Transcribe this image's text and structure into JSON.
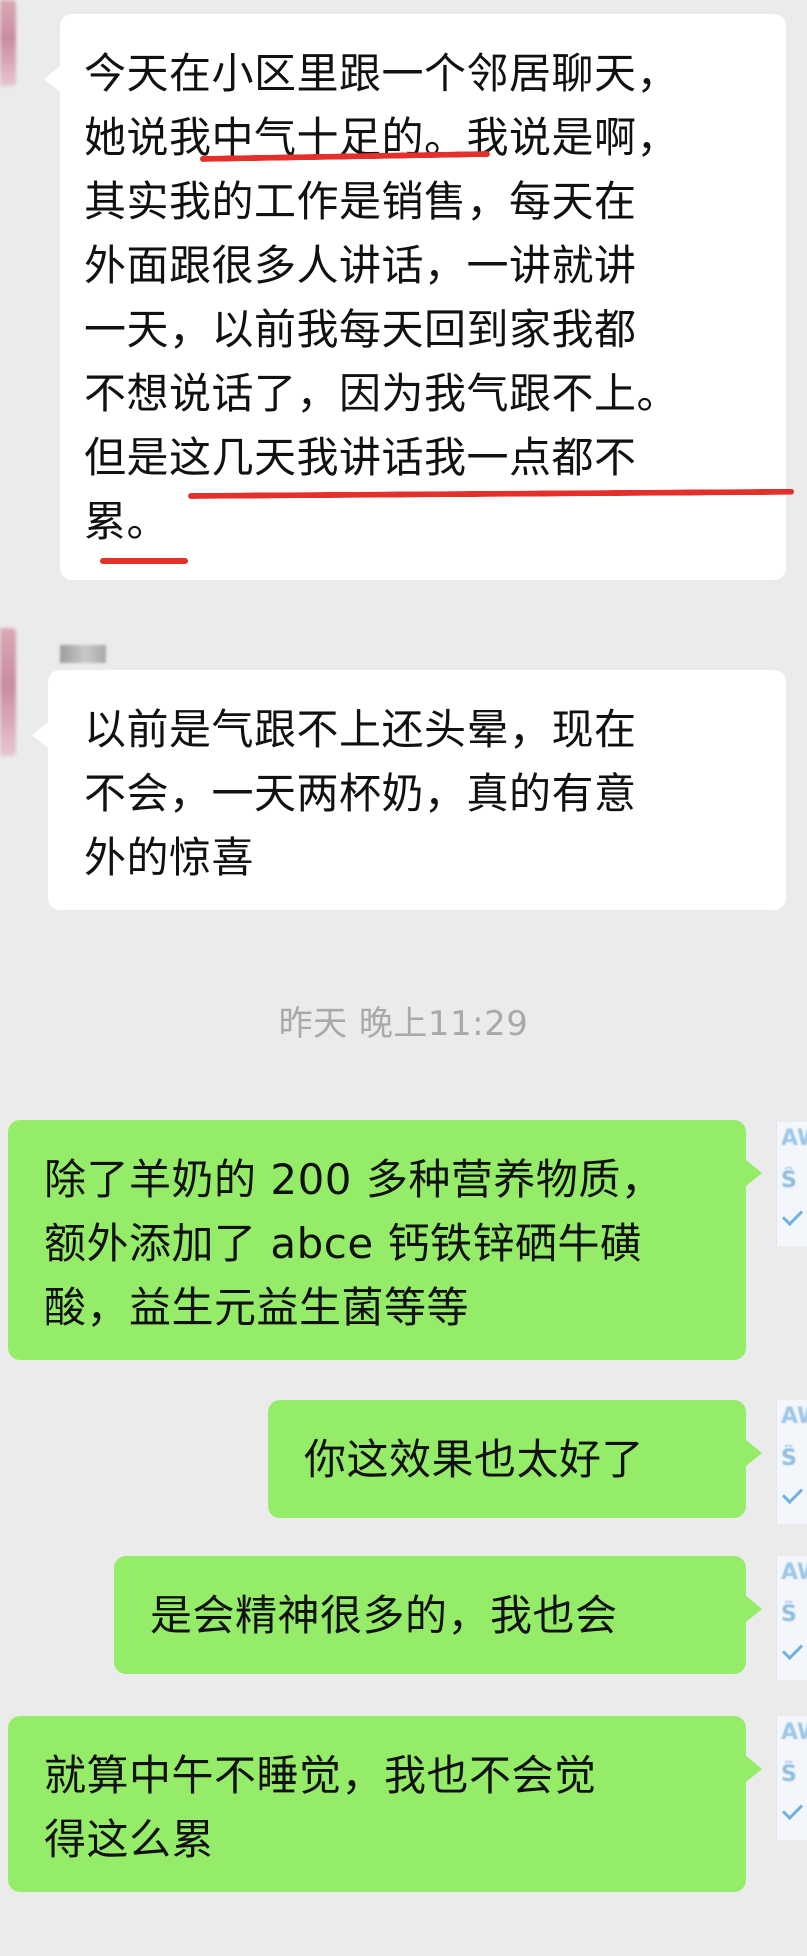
{
  "messages": [
    {
      "id": "m1",
      "sender": "contact",
      "lines": [
        "今天在小区里跟一个邻居聊天，",
        "她说我中气十足的。我说是啊，",
        "其实我的工作是销售，每天在",
        "外面跟很多人讲话，一讲就讲",
        "一天，以前我每天回到家我都",
        "不想说话了，因为我气跟不上。",
        "但是这几天我讲话我一点都不",
        "累。"
      ]
    },
    {
      "id": "m2",
      "sender": "contact",
      "lines": [
        "以前是气跟不上还头晕，现在",
        "不会，一天两杯奶，真的有意",
        "外的惊喜"
      ]
    },
    {
      "id": "m3",
      "sender": "self",
      "lines": [
        "除了羊奶的 200 多种营养物质，",
        "额外添加了 abce 钙铁锌硒牛磺",
        "酸，益生元益生菌等等"
      ]
    },
    {
      "id": "m4",
      "sender": "self",
      "lines": [
        "你这效果也太好了"
      ]
    },
    {
      "id": "m5",
      "sender": "self",
      "lines": [
        "是会精神很多的，我也会"
      ]
    },
    {
      "id": "m6",
      "sender": "self",
      "lines": [
        "就算中午不睡觉，我也不会觉",
        "得这么累"
      ]
    }
  ],
  "timestamp": "昨天 晚上11:29",
  "self_avatar_glyphs": [
    "AW",
    "Ŝ"
  ],
  "colors": {
    "background": "#ebebeb",
    "incoming_bubble": "#ffffff",
    "outgoing_bubble": "#95ec69",
    "highlight_mark": "#e3302b",
    "timestamp_text": "#a9a9a9"
  },
  "icons": {
    "contact_avatar": "blurred-avatar",
    "contact_nickname": "blurred-nickname",
    "self_avatar": "aw-logo-avatar"
  }
}
